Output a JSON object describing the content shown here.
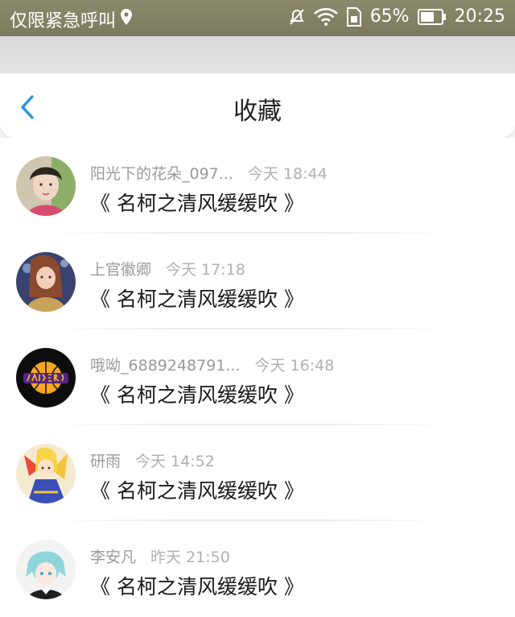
{
  "status_bar": {
    "carrier_text": "仅限紧急呼叫",
    "battery_percent": "65%",
    "time": "20:25",
    "icons": [
      "location-icon",
      "mute-icon",
      "wifi-icon",
      "sim-icon",
      "battery-icon"
    ],
    "battery_level": 0.65
  },
  "header": {
    "title": "收藏",
    "back_icon": "chevron-left-icon",
    "accent_color": "#2a93d5"
  },
  "favorites": [
    {
      "name": "阳光下的花朵_097...",
      "time": "今天 18:44",
      "message": "《 名柯之清风缓缓吹 》"
    },
    {
      "name": "上官徽卿",
      "time": "今天 17:18",
      "message": "《 名柯之清风缓缓吹 》"
    },
    {
      "name": "哦呦_6889248791...",
      "time": "今天 16:48",
      "message": "《 名柯之清风缓缓吹 》"
    },
    {
      "name": "研雨",
      "time": "今天 14:52",
      "message": "《 名柯之清风缓缓吹 》"
    },
    {
      "name": "李安凡",
      "time": "昨天 21:50",
      "message": "《 名柯之清风缓缓吹 》"
    }
  ]
}
